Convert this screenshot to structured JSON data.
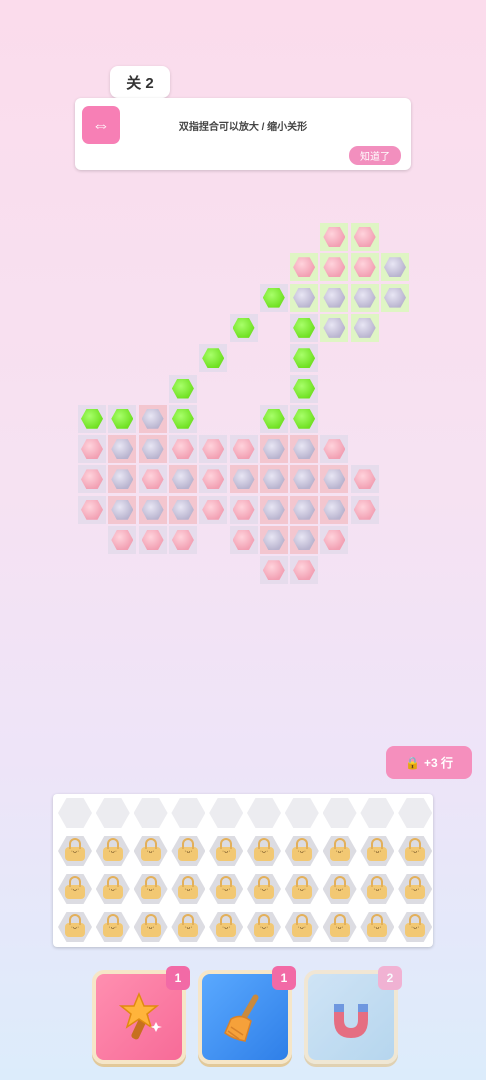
{
  "level": {
    "label": "关 2"
  },
  "tip": {
    "icon": "swap-icon",
    "text": "双指捏合可以放大 / 缩小关形",
    "ok_label": "知道了"
  },
  "board": {
    "columns": [
      "c0",
      "c1",
      "c2",
      "c3",
      "c4",
      "c5",
      "c6",
      "c7",
      "c8",
      "c9",
      "c10"
    ],
    "tiles": [
      {
        "c": 8,
        "r": 0,
        "color": "pink",
        "bg": "green"
      },
      {
        "c": 9,
        "r": 0,
        "color": "pink",
        "bg": "green"
      },
      {
        "c": 7,
        "r": 1,
        "color": "pink",
        "bg": "green"
      },
      {
        "c": 8,
        "r": 1,
        "color": "pink",
        "bg": "green"
      },
      {
        "c": 9,
        "r": 1,
        "color": "pink",
        "bg": "green"
      },
      {
        "c": 10,
        "r": 1,
        "color": "gray",
        "bg": "green"
      },
      {
        "c": 6,
        "r": 2,
        "color": "green",
        "bg": "gray"
      },
      {
        "c": 7,
        "r": 2,
        "color": "gray",
        "bg": "green"
      },
      {
        "c": 8,
        "r": 2,
        "color": "gray",
        "bg": "green"
      },
      {
        "c": 9,
        "r": 2,
        "color": "gray",
        "bg": "green"
      },
      {
        "c": 10,
        "r": 2,
        "color": "gray",
        "bg": "green"
      },
      {
        "c": 5,
        "r": 3,
        "color": "green",
        "bg": "gray"
      },
      {
        "c": 7,
        "r": 3,
        "color": "green",
        "bg": "gray"
      },
      {
        "c": 8,
        "r": 3,
        "color": "gray",
        "bg": "green"
      },
      {
        "c": 9,
        "r": 3,
        "color": "gray",
        "bg": "green"
      },
      {
        "c": 4,
        "r": 4,
        "color": "green",
        "bg": "gray"
      },
      {
        "c": 7,
        "r": 4,
        "color": "green",
        "bg": "gray"
      },
      {
        "c": 3,
        "r": 5,
        "color": "green",
        "bg": "gray"
      },
      {
        "c": 7,
        "r": 5,
        "color": "green",
        "bg": "gray"
      },
      {
        "c": 0,
        "r": 6,
        "color": "green",
        "bg": "gray"
      },
      {
        "c": 1,
        "r": 6,
        "color": "green",
        "bg": "gray"
      },
      {
        "c": 2,
        "r": 6,
        "color": "gray",
        "bg": "pink"
      },
      {
        "c": 3,
        "r": 6,
        "color": "green",
        "bg": "gray"
      },
      {
        "c": 6,
        "r": 6,
        "color": "green",
        "bg": "gray"
      },
      {
        "c": 7,
        "r": 6,
        "color": "green",
        "bg": "gray"
      },
      {
        "c": 0,
        "r": 7,
        "color": "pink",
        "bg": "gray"
      },
      {
        "c": 1,
        "r": 7,
        "color": "gray",
        "bg": "pink"
      },
      {
        "c": 2,
        "r": 7,
        "color": "gray",
        "bg": "pink"
      },
      {
        "c": 3,
        "r": 7,
        "color": "pink",
        "bg": "gray"
      },
      {
        "c": 4,
        "r": 7,
        "color": "pink",
        "bg": "gray"
      },
      {
        "c": 5,
        "r": 7,
        "color": "pink",
        "bg": "gray"
      },
      {
        "c": 6,
        "r": 7,
        "color": "gray",
        "bg": "pink"
      },
      {
        "c": 7,
        "r": 7,
        "color": "gray",
        "bg": "pink"
      },
      {
        "c": 8,
        "r": 7,
        "color": "pink",
        "bg": "gray"
      },
      {
        "c": 0,
        "r": 8,
        "color": "pink",
        "bg": "gray"
      },
      {
        "c": 1,
        "r": 8,
        "color": "gray",
        "bg": "pink"
      },
      {
        "c": 2,
        "r": 8,
        "color": "pink",
        "bg": "gray"
      },
      {
        "c": 3,
        "r": 8,
        "color": "gray",
        "bg": "pink"
      },
      {
        "c": 4,
        "r": 8,
        "color": "pink",
        "bg": "gray"
      },
      {
        "c": 5,
        "r": 8,
        "color": "gray",
        "bg": "pink"
      },
      {
        "c": 6,
        "r": 8,
        "color": "gray",
        "bg": "pink"
      },
      {
        "c": 7,
        "r": 8,
        "color": "gray",
        "bg": "pink"
      },
      {
        "c": 8,
        "r": 8,
        "color": "gray",
        "bg": "pink"
      },
      {
        "c": 9,
        "r": 8,
        "color": "pink",
        "bg": "gray"
      },
      {
        "c": 0,
        "r": 9,
        "color": "pink",
        "bg": "gray"
      },
      {
        "c": 1,
        "r": 9,
        "color": "gray",
        "bg": "pink"
      },
      {
        "c": 2,
        "r": 9,
        "color": "gray",
        "bg": "pink"
      },
      {
        "c": 3,
        "r": 9,
        "color": "gray",
        "bg": "pink"
      },
      {
        "c": 4,
        "r": 9,
        "color": "pink",
        "bg": "gray"
      },
      {
        "c": 5,
        "r": 9,
        "color": "pink",
        "bg": "gray"
      },
      {
        "c": 6,
        "r": 9,
        "color": "gray",
        "bg": "pink"
      },
      {
        "c": 7,
        "r": 9,
        "color": "gray",
        "bg": "pink"
      },
      {
        "c": 8,
        "r": 9,
        "color": "gray",
        "bg": "pink"
      },
      {
        "c": 9,
        "r": 9,
        "color": "pink",
        "bg": "gray"
      },
      {
        "c": 1,
        "r": 10,
        "color": "pink",
        "bg": "gray"
      },
      {
        "c": 2,
        "r": 10,
        "color": "pink",
        "bg": "gray"
      },
      {
        "c": 3,
        "r": 10,
        "color": "pink",
        "bg": "gray"
      },
      {
        "c": 5,
        "r": 10,
        "color": "pink",
        "bg": "gray"
      },
      {
        "c": 6,
        "r": 10,
        "color": "gray",
        "bg": "pink"
      },
      {
        "c": 7,
        "r": 10,
        "color": "gray",
        "bg": "pink"
      },
      {
        "c": 8,
        "r": 10,
        "color": "pink",
        "bg": "gray"
      },
      {
        "c": 6,
        "r": 11,
        "color": "pink",
        "bg": "gray"
      },
      {
        "c": 7,
        "r": 11,
        "color": "pink",
        "bg": "gray"
      }
    ]
  },
  "unlock_button": {
    "icon": "lock-icon",
    "label": "+3 行"
  },
  "tray": {
    "columns": 10,
    "empty_rows": 1,
    "locked_rows": 3
  },
  "tools": [
    {
      "name": "wand",
      "icon": "magic-wand-icon",
      "count": "1"
    },
    {
      "name": "broom",
      "icon": "broom-icon",
      "count": "1"
    },
    {
      "name": "magnet",
      "icon": "magnet-icon",
      "count": "2"
    }
  ],
  "colors": {
    "accent": "#f58fbd",
    "green": "#6fe021",
    "pink": "#f2a0b3",
    "gray": "#b9b4cf"
  }
}
